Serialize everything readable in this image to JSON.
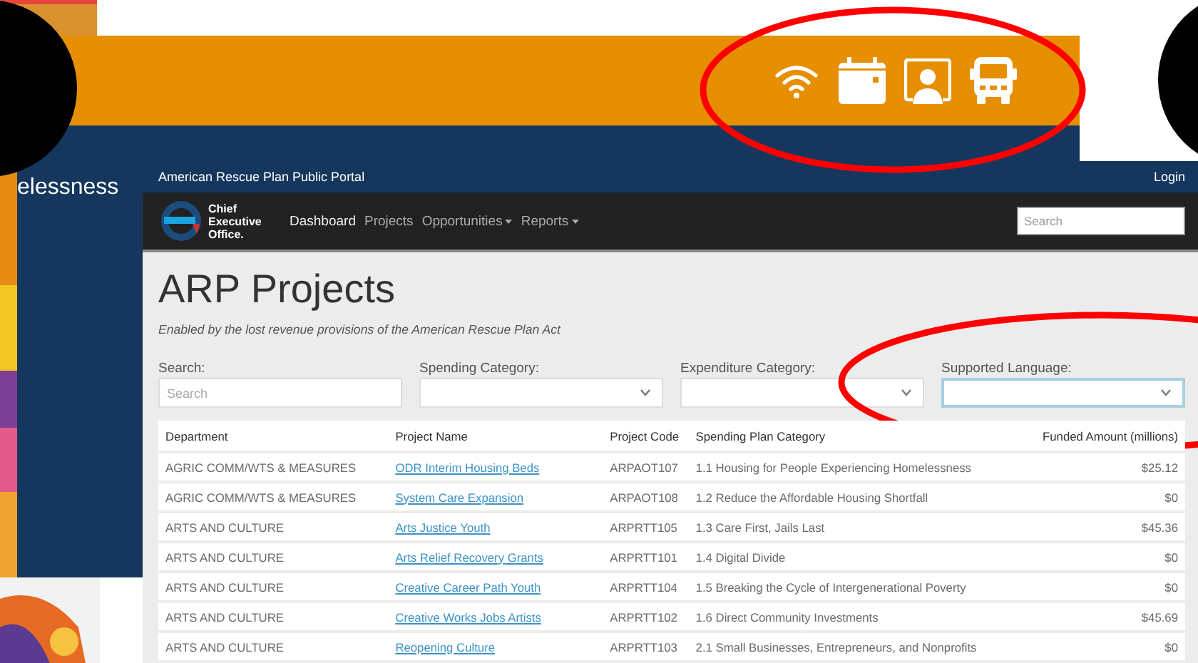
{
  "back_page": {
    "partial_heading": "elessness"
  },
  "portal": {
    "title": "American Rescue Plan Public Portal",
    "login": "Login",
    "logo_text": "Chief Executive Office.",
    "nav": [
      {
        "label": "Dashboard",
        "selected": true,
        "dropdown": false
      },
      {
        "label": "Projects",
        "selected": false,
        "dropdown": false
      },
      {
        "label": "Opportunities",
        "selected": false,
        "dropdown": true
      },
      {
        "label": "Reports",
        "selected": false,
        "dropdown": true
      }
    ],
    "search": {
      "placeholder": "Search"
    },
    "heading": "ARP Projects",
    "subtitle": "Enabled by the lost revenue provisions of the American Rescue Plan Act",
    "filters": [
      {
        "label": "Search:",
        "kind": "text",
        "placeholder": "Search",
        "focused": false
      },
      {
        "label": "Spending Category:",
        "kind": "select",
        "focused": false
      },
      {
        "label": "Expenditure Category:",
        "kind": "select",
        "focused": false
      },
      {
        "label": "Supported Language:",
        "kind": "select",
        "focused": true
      }
    ],
    "table": {
      "columns": [
        "Department",
        "Project Name",
        "Project Code",
        "Spending Plan Category",
        "Funded Amount (millions)"
      ],
      "rows": [
        {
          "department": "AGRIC COMM/WTS & MEASURES",
          "project_name": "ODR Interim Housing Beds",
          "project_code": "ARPAOT107",
          "category": "1.1 Housing for People Experiencing Homelessness",
          "amount": "$25.12"
        },
        {
          "department": "AGRIC COMM/WTS & MEASURES",
          "project_name": "System Care Expansion",
          "project_code": "ARPAOT108",
          "category": "1.2 Reduce the Affordable Housing Shortfall",
          "amount": "$0"
        },
        {
          "department": "ARTS AND CULTURE",
          "project_name": "Arts Justice Youth",
          "project_code": "ARPRTT105",
          "category": "1.3 Care First, Jails Last",
          "amount": "$45.36"
        },
        {
          "department": "ARTS AND CULTURE",
          "project_name": "Arts Relief Recovery Grants",
          "project_code": "ARPRTT101",
          "category": "1.4 Digital Divide",
          "amount": "$0"
        },
        {
          "department": "ARTS AND CULTURE",
          "project_name": "Creative Career Path Youth",
          "project_code": "ARPRTT104",
          "category": "1.5 Breaking the Cycle of Intergenerational Poverty",
          "amount": "$0"
        },
        {
          "department": "ARTS AND CULTURE",
          "project_name": "Creative Works Jobs Artists",
          "project_code": "ARPRTT102",
          "category": "1.6 Direct Community Investments",
          "amount": "$45.69"
        },
        {
          "department": "ARTS AND CULTURE",
          "project_name": "Reopening Culture",
          "project_code": "ARPRTT103",
          "category": "2.1 Small Businesses, Entrepreneurs, and Nonprofits",
          "amount": "$0"
        }
      ]
    }
  }
}
